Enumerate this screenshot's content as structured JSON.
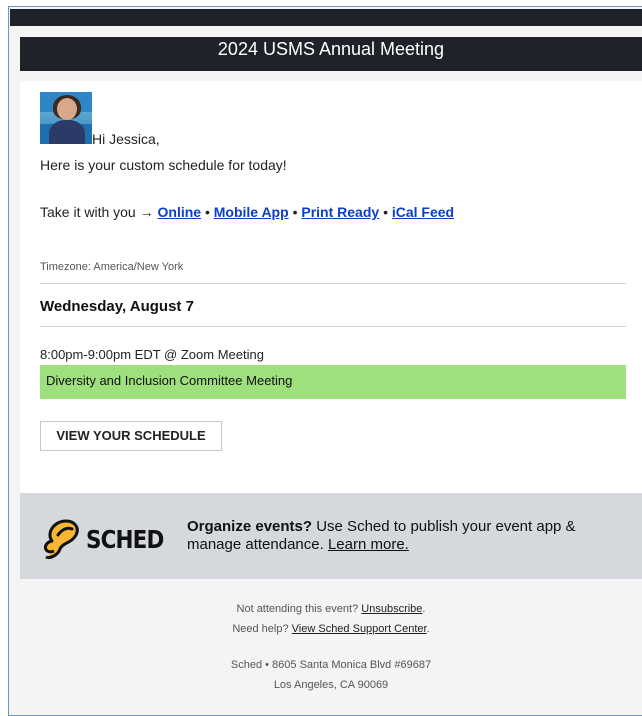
{
  "banner": {
    "title": "2024 USMS Annual Meeting"
  },
  "greeting": {
    "hi": "Hi Jessica,",
    "intro": "Here is your custom schedule for today!"
  },
  "takeaway": {
    "prefix": "Take it with you →",
    "links": [
      "Online",
      "Mobile App",
      "Print Ready",
      "iCal Feed"
    ],
    "separator": "•"
  },
  "schedule": {
    "timezone": "Timezone: America/New York",
    "day": "Wednesday, August 7",
    "time": "8:00pm-9:00pm EDT @ Zoom Meeting",
    "session": "Diversity and Inclusion Committee Meeting",
    "session_color": "#9ee07e",
    "button": "VIEW YOUR SCHEDULE"
  },
  "promo": {
    "logo": "SCHED",
    "bold": "Organize events?",
    "text": "Use Sched to publish your event app & manage attendance.",
    "link": "Learn more."
  },
  "footer": {
    "unsub_prefix": "Not attending this event?",
    "unsub_link": "Unsubscribe",
    "unsub_suffix": ".",
    "help_prefix": "Need help?",
    "help_link": "View Sched Support Center",
    "help_suffix": ".",
    "address1": "Sched • 8605 Santa Monica Blvd #69687",
    "address2": "Los Angeles, CA 90069"
  },
  "colors": {
    "banner_bg": "#1f2229",
    "link": "#0b3fc8",
    "promo_bg": "#d5d8dc"
  }
}
